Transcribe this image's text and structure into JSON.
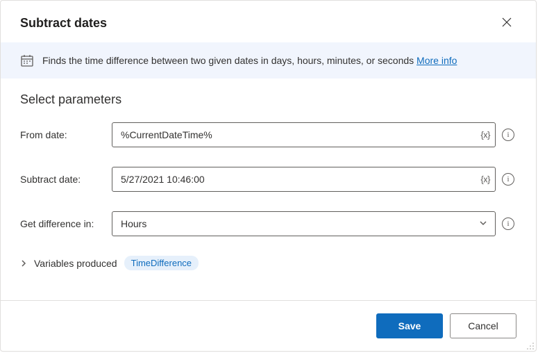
{
  "dialog": {
    "title": "Subtract dates",
    "description": "Finds the time difference between two given dates in days, hours, minutes, or seconds",
    "more_info_label": "More info"
  },
  "section": {
    "title": "Select parameters"
  },
  "fields": {
    "from_date": {
      "label": "From date:",
      "value": "%CurrentDateTime%",
      "suffix": "{x}"
    },
    "subtract_date": {
      "label": "Subtract date:",
      "value": "5/27/2021 10:46:00",
      "suffix": "{x}"
    },
    "get_difference": {
      "label": "Get difference in:",
      "value": "Hours"
    }
  },
  "variables": {
    "label": "Variables produced",
    "output": "TimeDifference"
  },
  "buttons": {
    "save": "Save",
    "cancel": "Cancel"
  }
}
